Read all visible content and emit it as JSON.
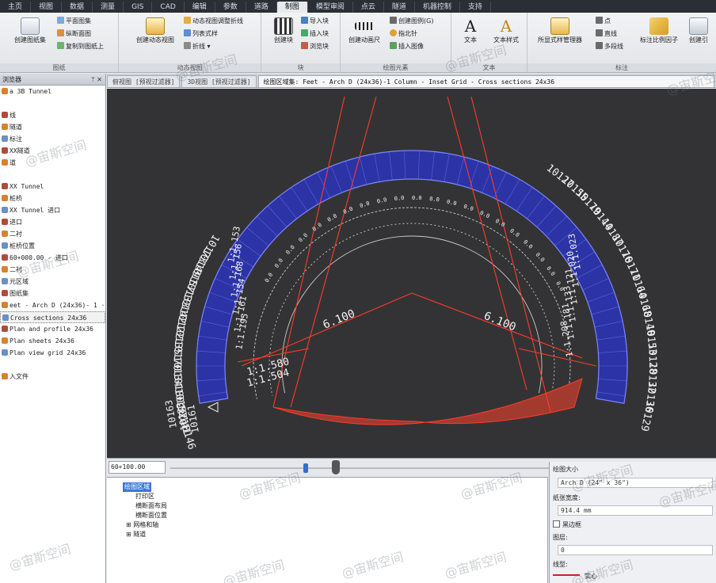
{
  "ribbon": {
    "tabs": [
      "主页",
      "视图",
      "数据",
      "测量",
      "GIS",
      "CAD",
      "编辑",
      "参数",
      "道路",
      "制图",
      "模型审阅",
      "点云",
      "隧道",
      "机器控制",
      "支持"
    ],
    "active_tab_index": 9,
    "groups": [
      {
        "title": "图纸",
        "big": [
          {
            "label": "创建图纸集",
            "icon": "sheet-set-icon"
          }
        ],
        "small": [
          "平面图集",
          "纵断面图",
          "复制到图纸上"
        ]
      },
      {
        "title": "动态视图",
        "big": [
          {
            "label": "创建动态视图",
            "icon": "dynamic-view-icon"
          }
        ],
        "small": [
          "动态视图调整折线",
          "列表式样",
          "折线 ▾"
        ]
      },
      {
        "title": "块",
        "big": [
          {
            "label": "创建块",
            "icon": "block-icon"
          }
        ],
        "small": [
          "导入块",
          "插入块",
          "浏览块"
        ]
      },
      {
        "title": "绘图元素",
        "big": [
          {
            "label": "创建动画尺",
            "icon": "animation-ruler-icon"
          }
        ],
        "small": [
          "创建图例(G)",
          "指北针",
          "插入图像"
        ]
      },
      {
        "title": "文本",
        "big": [
          {
            "label": "文本",
            "icon": "text-icon"
          },
          {
            "label": "文本样式",
            "icon": "text-style-icon"
          }
        ],
        "small": []
      },
      {
        "title": "标注",
        "big": [
          {
            "label": "所显式样管理器",
            "icon": "style-manager-icon"
          },
          {
            "label": "标注比例因子",
            "icon": "annotation-scale-icon"
          },
          {
            "label": "创建引",
            "icon": "leader-icon"
          }
        ],
        "small": [
          "点",
          "直线",
          "多段线"
        ]
      }
    ]
  },
  "left_panel": {
    "title": "浏览器",
    "items": [
      "a 3B Tunnel",
      "",
      "线",
      "隧道",
      "标注",
      "XX隧道",
      "道",
      "",
      "XX Tunnel",
      "桩桥",
      "XX Tunnel 进口",
      "进口",
      "二衬",
      "桩桥位置",
      "60+000.00 - 进口",
      "二衬",
      "元区域",
      "图纸集",
      "eet - Arch D (24x36)- 1 ···",
      "Cross sections 24x36",
      "Plan and profile 24x36",
      "Plan sheets 24x36",
      "Plan view grid 24x36",
      "",
      "入文件"
    ],
    "selected_index": 19
  },
  "doc_tabs": [
    {
      "label": "俯视图 [预视过滤器]"
    },
    {
      "label": "3D视图 [预视过滤器]"
    },
    {
      "label": "绘图区域集: Feet - Arch D (24x36)-1 Column - Inset Grid - Cross sections 24x36",
      "active": true
    }
  ],
  "drawing": {
    "dimension_labels": [
      "6.100",
      "6.100"
    ],
    "slope_left": [
      "1:1.153",
      "1:1.156",
      "1:1.168",
      "1:1.154",
      "1:1.161",
      "1:1.195"
    ],
    "slope_right": [
      "1:1.023",
      "1:1.020",
      "1:1.121",
      "1:1.133",
      "1:1.181",
      "1:1.208"
    ],
    "slope_bottom_left": [
      "1:1.580",
      "1:1.504"
    ],
    "station_labels_left": [
      "10173",
      "10149",
      "10157",
      "10133",
      "10142",
      "10122",
      "10135",
      "10170",
      "10134",
      "10180",
      "10152",
      "10141",
      "10146"
    ],
    "station_labels_right": [
      "10127",
      "10155",
      "10179",
      "10144",
      "10187",
      "10176",
      "10171",
      "10164",
      "10168",
      "10140",
      "10153",
      "10128",
      "10132",
      "10136",
      "10129"
    ],
    "station_labels_bottom": [
      "10163",
      "10183",
      "10161"
    ],
    "colors": {
      "background": "#333335",
      "ring_fill": "#2b34b8",
      "ring_stroke": "#7b86ff",
      "invert_fill": "#a33a2f",
      "red_line": "#ff3a2a",
      "label": "#f2f2f2"
    }
  },
  "status": {
    "scale_value": "60+100.00"
  },
  "bottom_tree": {
    "items": [
      {
        "label": "绘图区域",
        "selected": true
      },
      {
        "label": "打印区"
      },
      {
        "label": "横断面布局"
      },
      {
        "label": "横断面位置"
      },
      {
        "label": "⊞ 网格和轴"
      },
      {
        "label": "⊞ 隧道"
      }
    ]
  },
  "properties": {
    "header": "绘图大小",
    "paper_size": "Arch D (24\" x 36\")",
    "paper_width_label": "纸张宽度:",
    "paper_width_value": "914.4 mm",
    "border_checkbox_label": "黑边框",
    "layer_label": "图层:",
    "layer_value": "0",
    "linetype_label": "线型:",
    "linetype_value": "实心"
  },
  "watermark": "@宙斯空间"
}
